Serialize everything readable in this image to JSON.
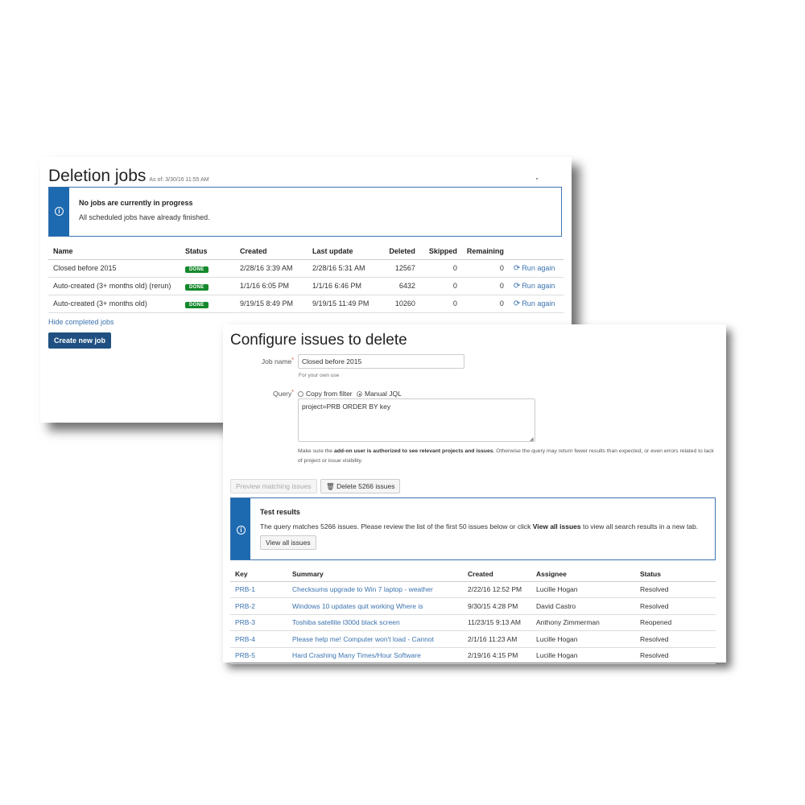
{
  "jobs_panel": {
    "title": "Deletion jobs",
    "as_of": "As of: 3/30/16 11:55 AM",
    "info": {
      "heading": "No jobs are currently in progress",
      "message": "All scheduled jobs have already finished.",
      "icon": "info-icon"
    },
    "columns": [
      "Name",
      "Status",
      "Created",
      "Last update",
      "Deleted",
      "Skipped",
      "Remaining"
    ],
    "rows": [
      {
        "name": "Closed before 2015",
        "status": "DONE",
        "created": "2/28/16 3:39 AM",
        "last_update": "2/28/16 5:31 AM",
        "deleted": "12567",
        "skipped": "0",
        "remaining": "0",
        "action": "Run again"
      },
      {
        "name": "Auto-created (3+ months old) (rerun)",
        "status": "DONE",
        "created": "1/1/16 6:05 PM",
        "last_update": "1/1/16 6:46 PM",
        "deleted": "6432",
        "skipped": "0",
        "remaining": "0",
        "action": "Run again"
      },
      {
        "name": "Auto-created (3+ months old)",
        "status": "DONE",
        "created": "9/19/15 8:49 PM",
        "last_update": "9/19/15 11:49 PM",
        "deleted": "10260",
        "skipped": "0",
        "remaining": "0",
        "action": "Run again"
      }
    ],
    "hide_link": "Hide completed jobs",
    "create_button": "Create new job",
    "colors": {
      "done_badge": "#14892c",
      "primary_button": "#205081",
      "info_bar": "#1d6ab0",
      "link": "#3b73af"
    }
  },
  "config_panel": {
    "title": "Configure issues to delete",
    "job_name_label": "Job name",
    "job_name_value": "Closed before 2015",
    "job_name_hint": "For your own use",
    "query_label": "Query",
    "query_options": [
      "Copy from filter",
      "Manual JQL"
    ],
    "query_selected": "Manual JQL",
    "jql": "project=PRB ORDER BY key",
    "warning_pre": "Make sure the ",
    "warning_bold": "add-on user is authorized to see relevant projects and issues",
    "warning_post": ". Otherwise the query may return fewer results than expected, or even errors related to lack of project or issue visibility.",
    "preview_button": "Preview matching issues",
    "delete_button": "Delete 5266 issues",
    "delete_icon": "trash-icon",
    "results": {
      "heading": "Test results",
      "message_pre": "The query matches 5266 issues. Please review the list of the first 50 issues below or click ",
      "message_bold": "View all issues",
      "message_post": " to view all search results in a new tab.",
      "view_all_button": "View all issues"
    },
    "columns": [
      "Key",
      "Summary",
      "Created",
      "Assignee",
      "Status"
    ],
    "issues": [
      {
        "key": "PRB-1",
        "summary": "Checksums upgrade to Win 7 laptop - weather",
        "created": "2/22/16 12:52 PM",
        "assignee": "Lucille Hogan",
        "status": "Resolved"
      },
      {
        "key": "PRB-2",
        "summary": "Windows 10 updates quit working Where is",
        "created": "9/30/15 4:28 PM",
        "assignee": "David Castro",
        "status": "Resolved"
      },
      {
        "key": "PRB-3",
        "summary": "Toshiba satellite l300d black screen",
        "created": "11/23/15 9:13 AM",
        "assignee": "Anthony Zimmerman",
        "status": "Reopened"
      },
      {
        "key": "PRB-4",
        "summary": "Please help me! Computer won't load - Cannot",
        "created": "2/1/16 11:23 AM",
        "assignee": "Lucille Hogan",
        "status": "Resolved"
      },
      {
        "key": "PRB-5",
        "summary": "Hard Crashing Many Times/Hour Software",
        "created": "2/19/16 4:15 PM",
        "assignee": "Lucille Hogan",
        "status": "Resolved"
      }
    ]
  }
}
